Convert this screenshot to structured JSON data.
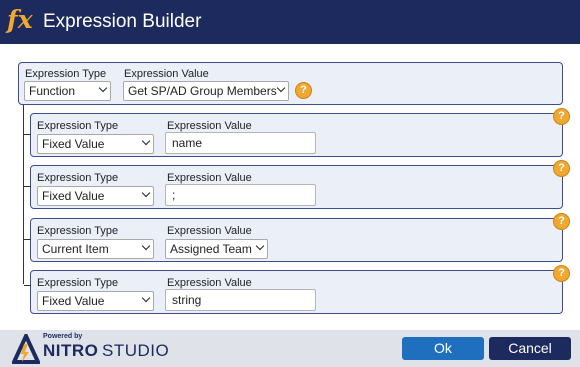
{
  "dialog": {
    "title": "Expression Builder",
    "fx_symbol": "fx"
  },
  "root": {
    "type_label": "Expression Type",
    "value_label": "Expression Value",
    "type": "Function",
    "value": "Get SP/AD Group Members"
  },
  "params": [
    {
      "type_label": "Expression Type",
      "value_label": "Expression Value",
      "type": "Fixed Value",
      "value": "name"
    },
    {
      "type_label": "Expression Type",
      "value_label": "Expression Value",
      "type": "Fixed Value",
      "value": ";"
    },
    {
      "type_label": "Expression Type",
      "value_label": "Expression Value",
      "type": "Current Item",
      "value": "Assigned Team"
    },
    {
      "type_label": "Expression Type",
      "value_label": "Expression Value",
      "type": "Fixed Value",
      "value": "string"
    }
  ],
  "help_glyph": "?",
  "footer": {
    "powered_by": "Powered by",
    "brand_a": "NITRO",
    "brand_b": "STUDIO",
    "ok_label": "Ok",
    "cancel_label": "Cancel"
  },
  "colors": {
    "titlebar": "#1d2a5e",
    "row_bg": "#ebf0f8",
    "row_border": "#3b4f8a",
    "help": "#f0a830",
    "ok_button": "#1f6fbf",
    "cancel_button": "#1d2a5e"
  },
  "icons": [
    "fx-icon",
    "help-icon",
    "chevron-down-icon",
    "nitro-logo-icon"
  ]
}
